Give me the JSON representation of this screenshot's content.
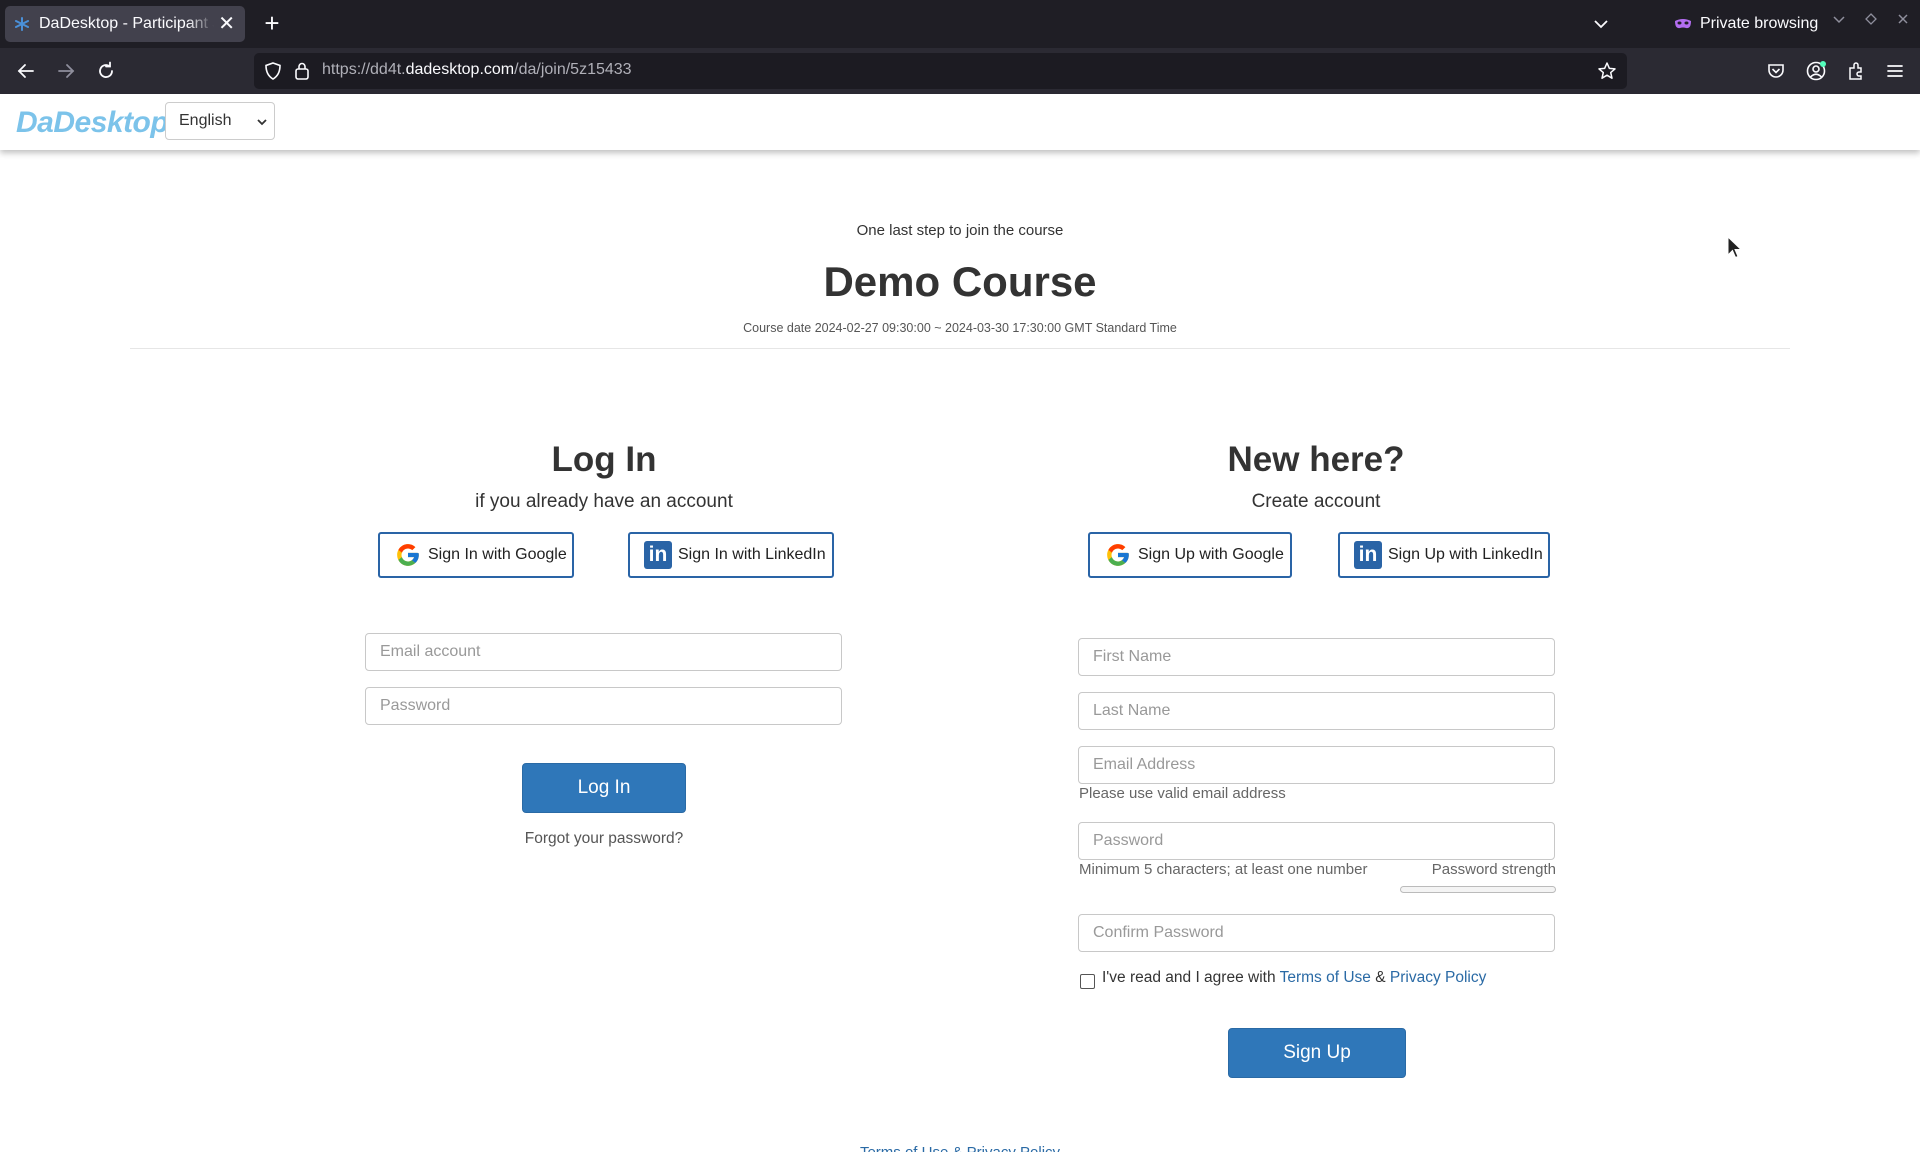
{
  "browser": {
    "tab_title": "DaDesktop - Participant Join",
    "new_tab_symbol": "+",
    "close_symbol": "✕",
    "private_label": "Private browsing",
    "url_prefix": "https://dd4t.",
    "url_domain": "dadesktop.com",
    "url_path": "/da/join/5z15433"
  },
  "header": {
    "brand": "DaDesktop",
    "language": "English"
  },
  "course": {
    "intro": "One last step to join the course",
    "title": "Demo Course",
    "date": "Course date 2024-02-27 09:30:00 ~ 2024-03-30 17:30:00 GMT Standard Time"
  },
  "login": {
    "title": "Log In",
    "subtitle": "if you already have an account",
    "google_button": "Sign In with Google",
    "linkedin_button": "Sign In with LinkedIn",
    "email_placeholder": "Email account",
    "password_placeholder": "Password",
    "submit": "Log In",
    "forgot": "Forgot your password?"
  },
  "signup": {
    "title": "New here?",
    "subtitle": "Create account",
    "google_button": "Sign Up with Google",
    "linkedin_button": "Sign Up with LinkedIn",
    "first_name_placeholder": "First Name",
    "last_name_placeholder": "Last Name",
    "email_placeholder": "Email Address",
    "email_hint": "Please use valid email address",
    "password_placeholder": "Password",
    "password_hint": "Minimum 5 characters; at least one number",
    "strength_label": "Password strength",
    "strength_value": 0,
    "confirm_placeholder": "Confirm Password",
    "agree_text": "I've read and I agree with",
    "terms_link": "Terms of Use",
    "amp": "&",
    "privacy_link": "Privacy Policy",
    "submit": "Sign Up"
  },
  "footer": {
    "terms": "Terms of Use",
    "amp": "&",
    "privacy": "Privacy Policy"
  },
  "colors": {
    "brand": "#7cc3ea",
    "primary": "#2f77b9",
    "social_border": "#2a64a6"
  }
}
